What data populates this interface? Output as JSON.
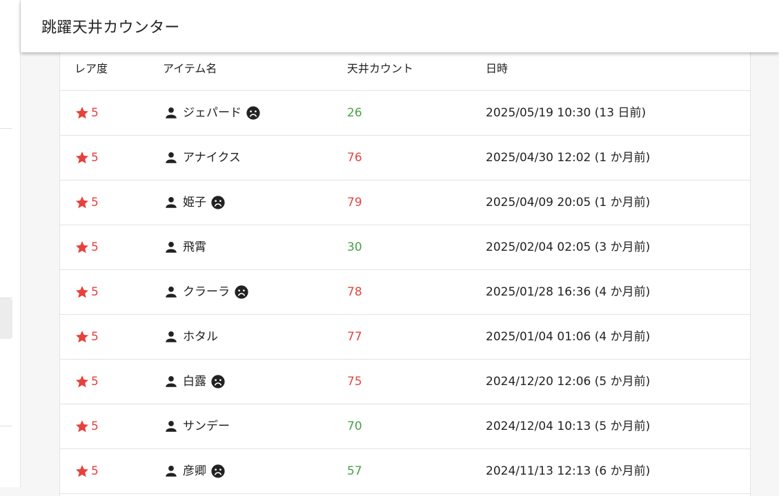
{
  "app": {
    "title": "跳躍天井カウンター"
  },
  "colors": {
    "rarity": "#e8403a",
    "count_high": "#e0473f",
    "count_low": "#4a9e4a"
  },
  "table": {
    "headers": {
      "rarity": "レア度",
      "name": "アイテム名",
      "count": "天井カウント",
      "date": "日時"
    },
    "rows": [
      {
        "rarity": "5",
        "name": "ジェパード",
        "sad": true,
        "count": "26",
        "count_level": "low",
        "date": "2025/05/19 10:30 (13 日前)"
      },
      {
        "rarity": "5",
        "name": "アナイクス",
        "sad": false,
        "count": "76",
        "count_level": "high",
        "date": "2025/04/30 12:02 (1 か月前)"
      },
      {
        "rarity": "5",
        "name": "姫子",
        "sad": true,
        "count": "79",
        "count_level": "high",
        "date": "2025/04/09 20:05 (1 か月前)"
      },
      {
        "rarity": "5",
        "name": "飛霄",
        "sad": false,
        "count": "30",
        "count_level": "low",
        "date": "2025/02/04 02:05 (3 か月前)"
      },
      {
        "rarity": "5",
        "name": "クラーラ",
        "sad": true,
        "count": "78",
        "count_level": "high",
        "date": "2025/01/28 16:36 (4 か月前)"
      },
      {
        "rarity": "5",
        "name": "ホタル",
        "sad": false,
        "count": "77",
        "count_level": "high",
        "date": "2025/01/04 01:06 (4 か月前)"
      },
      {
        "rarity": "5",
        "name": "白露",
        "sad": true,
        "count": "75",
        "count_level": "high",
        "date": "2024/12/20 12:06 (5 か月前)"
      },
      {
        "rarity": "5",
        "name": "サンデー",
        "sad": false,
        "count": "70",
        "count_level": "low",
        "date": "2024/12/04 10:13 (5 か月前)"
      },
      {
        "rarity": "5",
        "name": "彦卿",
        "sad": true,
        "count": "57",
        "count_level": "low",
        "date": "2024/11/13 12:13 (6 か月前)"
      }
    ]
  }
}
